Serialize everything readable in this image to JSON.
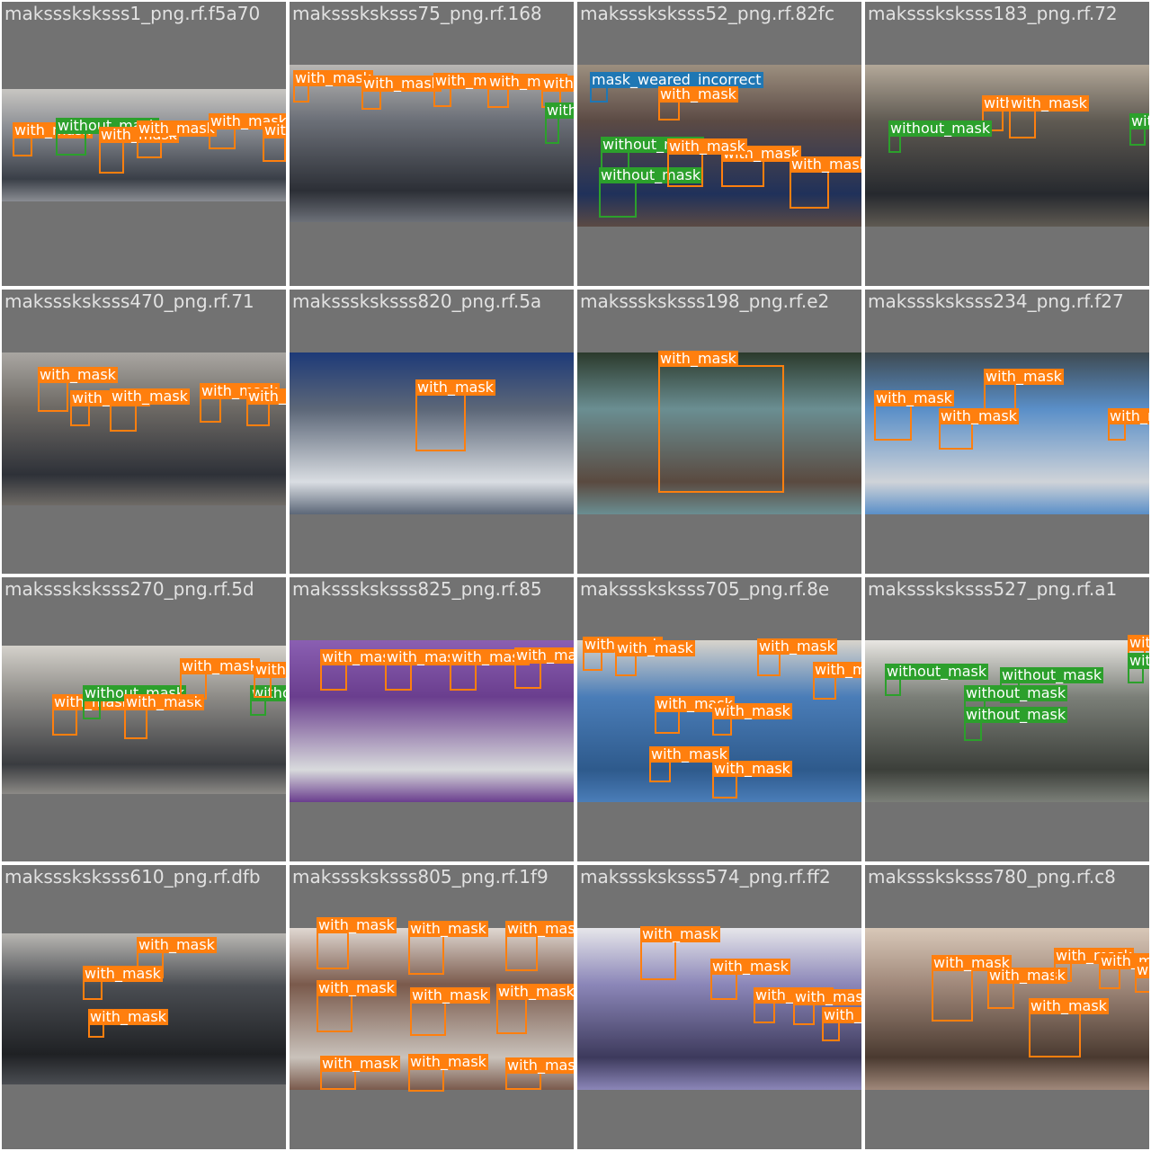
{
  "mosaic": {
    "tiles": [
      {
        "title": "maksssksksss1_png.rf.f5a70",
        "photo_colors": [
          "#3a3f48",
          "#8a8d93",
          "#c8c6c2"
        ],
        "detections": [
          {
            "label": "with_mask",
            "cls": "with_mask"
          },
          {
            "label": "without_mask",
            "cls": "without_mask"
          },
          {
            "label": "with_mask",
            "cls": "with_mask"
          },
          {
            "label": "with_mask",
            "cls": "with_mask"
          },
          {
            "label": "with_mask",
            "cls": "with_mask"
          },
          {
            "label": "with_mask",
            "cls": "with_mask"
          }
        ]
      },
      {
        "title": "maksssksksss75_png.rf.168",
        "photo_colors": [
          "#2c2f36",
          "#6c7078",
          "#b9b7b4"
        ],
        "detections": [
          {
            "label": "with_mask",
            "cls": "with_mask"
          },
          {
            "label": "with_mask",
            "cls": "with_mask"
          },
          {
            "label": "with_mask",
            "cls": "with_mask"
          },
          {
            "label": "with_mask",
            "cls": "with_mask"
          },
          {
            "label": "with_mask",
            "cls": "with_mask"
          },
          {
            "label": "without_mask",
            "cls": "without_mask"
          }
        ]
      },
      {
        "title": "maksssksksss52_png.rf.82fc",
        "photo_colors": [
          "#20315a",
          "#5b4a44",
          "#9c8f7f"
        ],
        "detections": [
          {
            "label": "mask_weared_incorrect",
            "cls": "mask_weared_incorrect"
          },
          {
            "label": "with_mask",
            "cls": "with_mask"
          },
          {
            "label": "without_mask",
            "cls": "without_mask"
          },
          {
            "label": "with_mask",
            "cls": "with_mask"
          },
          {
            "label": "without_mask",
            "cls": "without_mask"
          },
          {
            "label": "with_mask",
            "cls": "with_mask"
          },
          {
            "label": "with_mask",
            "cls": "with_mask"
          }
        ]
      },
      {
        "title": "maksssksksss183_png.rf.72",
        "photo_colors": [
          "#26292e",
          "#5f5a52",
          "#b3a899"
        ],
        "detections": [
          {
            "label": "with_mask",
            "cls": "with_mask"
          },
          {
            "label": "with_mask",
            "cls": "with_mask"
          },
          {
            "label": "without_mask",
            "cls": "without_mask"
          },
          {
            "label": "without_mask",
            "cls": "without_mask"
          }
        ]
      },
      {
        "title": "maksssksksss470_png.rf.71",
        "photo_colors": [
          "#2e3138",
          "#6f6b66",
          "#a9a6a2"
        ],
        "detections": [
          {
            "label": "with_mask",
            "cls": "with_mask"
          },
          {
            "label": "with_mask",
            "cls": "with_mask"
          },
          {
            "label": "with_mask",
            "cls": "with_mask"
          },
          {
            "label": "with_mask",
            "cls": "with_mask"
          },
          {
            "label": "with_mask",
            "cls": "with_mask"
          }
        ]
      },
      {
        "title": "maksssksksss820_png.rf.5a",
        "photo_colors": [
          "#d9dde2",
          "#5c6778",
          "#1d3a78"
        ],
        "detections": [
          {
            "label": "with_mask",
            "cls": "with_mask"
          }
        ]
      },
      {
        "title": "maksssksksss198_png.rf.e2",
        "photo_colors": [
          "#5a4a40",
          "#6a8e92",
          "#2b3a2c"
        ],
        "detections": [
          {
            "label": "with_mask",
            "cls": "with_mask"
          }
        ]
      },
      {
        "title": "maksssksksss234_png.rf.f27",
        "photo_colors": [
          "#cfd3d8",
          "#5a8fc8",
          "#3e4a52"
        ],
        "detections": [
          {
            "label": "with_mask",
            "cls": "with_mask"
          },
          {
            "label": "with_mask",
            "cls": "with_mask"
          },
          {
            "label": "with_mask",
            "cls": "with_mask"
          },
          {
            "label": "with_mask",
            "cls": "with_mask"
          }
        ]
      },
      {
        "title": "maksssksksss270_png.rf.5d",
        "photo_colors": [
          "#3a3c40",
          "#8c8a86",
          "#d4d1cb"
        ],
        "detections": [
          {
            "label": "with_mask",
            "cls": "with_mask"
          },
          {
            "label": "without_mask",
            "cls": "without_mask"
          },
          {
            "label": "with_mask",
            "cls": "with_mask"
          },
          {
            "label": "with_mask",
            "cls": "with_mask"
          },
          {
            "label": "without_mask",
            "cls": "without_mask"
          },
          {
            "label": "with_mask",
            "cls": "with_mask"
          }
        ]
      },
      {
        "title": "maksssksksss825_png.rf.85",
        "photo_colors": [
          "#d8dadc",
          "#6a3e8e",
          "#8a5fb2"
        ],
        "detections": [
          {
            "label": "with_mask",
            "cls": "with_mask"
          },
          {
            "label": "with_mask",
            "cls": "with_mask"
          },
          {
            "label": "with_mask",
            "cls": "with_mask"
          },
          {
            "label": "with_mask",
            "cls": "with_mask"
          }
        ]
      },
      {
        "title": "maksssksksss705_png.rf.8e",
        "photo_colors": [
          "#2e5a8c",
          "#4a7db8",
          "#d8d4cc"
        ],
        "detections": [
          {
            "label": "with_mask",
            "cls": "with_mask"
          },
          {
            "label": "with_mask",
            "cls": "with_mask"
          },
          {
            "label": "with_mask",
            "cls": "with_mask"
          },
          {
            "label": "with_mask",
            "cls": "with_mask"
          },
          {
            "label": "with_mask",
            "cls": "with_mask"
          },
          {
            "label": "with_mask",
            "cls": "with_mask"
          },
          {
            "label": "with_mask",
            "cls": "with_mask"
          },
          {
            "label": "with_mask",
            "cls": "with_mask"
          }
        ]
      },
      {
        "title": "maksssksksss527_png.rf.a1",
        "photo_colors": [
          "#3c3f3a",
          "#7b7f78",
          "#e8e6e2"
        ],
        "detections": [
          {
            "label": "without_mask",
            "cls": "without_mask"
          },
          {
            "label": "without_mask",
            "cls": "without_mask"
          },
          {
            "label": "without_mask",
            "cls": "without_mask"
          },
          {
            "label": "without_mask",
            "cls": "without_mask"
          },
          {
            "label": "with_mask",
            "cls": "with_mask"
          },
          {
            "label": "without_mask",
            "cls": "without_mask"
          }
        ]
      },
      {
        "title": "maksssksksss610_png.rf.dfb",
        "photo_colors": [
          "#1f2124",
          "#4a4d52",
          "#b8b6b2"
        ],
        "detections": [
          {
            "label": "with_mask",
            "cls": "with_mask"
          },
          {
            "label": "with_mask",
            "cls": "with_mask"
          },
          {
            "label": "with_mask",
            "cls": "with_mask"
          }
        ]
      },
      {
        "title": "maksssksksss805_png.rf.1f9",
        "photo_colors": [
          "#c9c2bb",
          "#7a5a4c",
          "#e0d8d2"
        ],
        "detections": [
          {
            "label": "with_mask",
            "cls": "with_mask"
          },
          {
            "label": "with_mask",
            "cls": "with_mask"
          },
          {
            "label": "with_mask",
            "cls": "with_mask"
          },
          {
            "label": "with_mask",
            "cls": "with_mask"
          },
          {
            "label": "with_mask",
            "cls": "with_mask"
          },
          {
            "label": "with_mask",
            "cls": "with_mask"
          },
          {
            "label": "with_mask",
            "cls": "with_mask"
          },
          {
            "label": "with_mask",
            "cls": "with_mask"
          },
          {
            "label": "with_mask",
            "cls": "with_mask"
          }
        ]
      },
      {
        "title": "maksssksksss574_png.rf.ff2",
        "photo_colors": [
          "#3d3a5c",
          "#8b86b8",
          "#e6e6ea"
        ],
        "detections": [
          {
            "label": "with_mask",
            "cls": "with_mask"
          },
          {
            "label": "with_mask",
            "cls": "with_mask"
          },
          {
            "label": "with_mask",
            "cls": "with_mask"
          },
          {
            "label": "with_mask",
            "cls": "with_mask"
          },
          {
            "label": "with_mask",
            "cls": "with_mask"
          }
        ]
      },
      {
        "title": "maksssksksss780_png.rf.c8",
        "photo_colors": [
          "#4a3a30",
          "#a0887a",
          "#d8c8b8"
        ],
        "detections": [
          {
            "label": "with_mask",
            "cls": "with_mask"
          },
          {
            "label": "with_mask",
            "cls": "with_mask"
          },
          {
            "label": "with_mask",
            "cls": "with_mask"
          },
          {
            "label": "with_mask",
            "cls": "with_mask"
          },
          {
            "label": "with_mask",
            "cls": "with_mask"
          },
          {
            "label": "with_mask",
            "cls": "with_mask"
          }
        ]
      }
    ]
  },
  "class_colors": {
    "with_mask": "#ff7f0e",
    "without_mask": "#2ca02c",
    "mask_weared_incorrect": "#1f77b4"
  }
}
